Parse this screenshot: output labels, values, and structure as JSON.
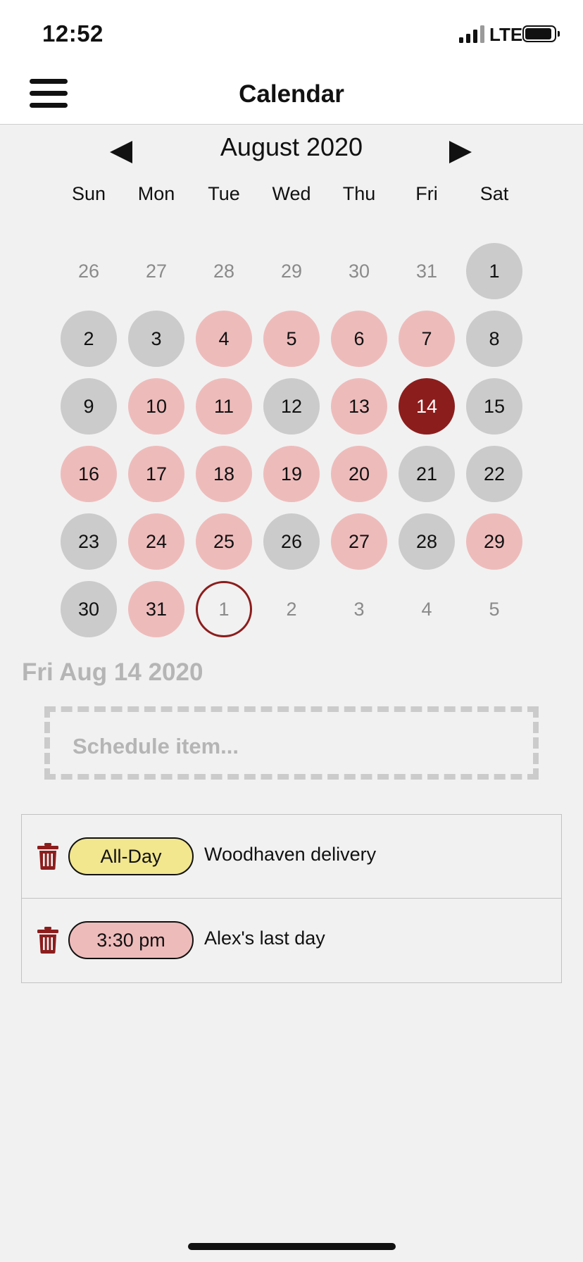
{
  "status_bar": {
    "time": "12:52",
    "network": "LTE"
  },
  "nav": {
    "title": "Calendar",
    "menu_icon": "hamburger-menu-icon"
  },
  "calendar": {
    "month_label": "August 2020",
    "prev_icon": "triangle-left-icon",
    "next_icon": "triangle-right-icon",
    "weekdays": [
      "Sun",
      "Mon",
      "Tue",
      "Wed",
      "Thu",
      "Fri",
      "Sat"
    ],
    "legend_colors": {
      "free": "#cbcbcb",
      "busy": "#eebbbb",
      "selected": "#8c1d1d",
      "today_ring": "#8c1d1d"
    },
    "days": [
      {
        "label": "26",
        "state": "out"
      },
      {
        "label": "27",
        "state": "out"
      },
      {
        "label": "28",
        "state": "out"
      },
      {
        "label": "29",
        "state": "out"
      },
      {
        "label": "30",
        "state": "out"
      },
      {
        "label": "31",
        "state": "out"
      },
      {
        "label": "1",
        "state": "free"
      },
      {
        "label": "2",
        "state": "free"
      },
      {
        "label": "3",
        "state": "free"
      },
      {
        "label": "4",
        "state": "busy"
      },
      {
        "label": "5",
        "state": "busy"
      },
      {
        "label": "6",
        "state": "busy"
      },
      {
        "label": "7",
        "state": "busy"
      },
      {
        "label": "8",
        "state": "free"
      },
      {
        "label": "9",
        "state": "free"
      },
      {
        "label": "10",
        "state": "busy"
      },
      {
        "label": "11",
        "state": "busy"
      },
      {
        "label": "12",
        "state": "free"
      },
      {
        "label": "13",
        "state": "busy"
      },
      {
        "label": "14",
        "state": "selected"
      },
      {
        "label": "15",
        "state": "free"
      },
      {
        "label": "16",
        "state": "busy"
      },
      {
        "label": "17",
        "state": "busy"
      },
      {
        "label": "18",
        "state": "busy"
      },
      {
        "label": "19",
        "state": "busy"
      },
      {
        "label": "20",
        "state": "busy"
      },
      {
        "label": "21",
        "state": "free"
      },
      {
        "label": "22",
        "state": "free"
      },
      {
        "label": "23",
        "state": "free"
      },
      {
        "label": "24",
        "state": "busy"
      },
      {
        "label": "25",
        "state": "busy"
      },
      {
        "label": "26",
        "state": "free"
      },
      {
        "label": "27",
        "state": "busy"
      },
      {
        "label": "28",
        "state": "free"
      },
      {
        "label": "29",
        "state": "busy"
      },
      {
        "label": "30",
        "state": "free"
      },
      {
        "label": "31",
        "state": "busy"
      },
      {
        "label": "1",
        "state": "today"
      },
      {
        "label": "2",
        "state": "out"
      },
      {
        "label": "3",
        "state": "out"
      },
      {
        "label": "4",
        "state": "out"
      },
      {
        "label": "5",
        "state": "out"
      }
    ]
  },
  "selected_date_label": "Fri Aug 14 2020",
  "schedule_input": {
    "placeholder": "Schedule item...",
    "value": ""
  },
  "events": [
    {
      "time_label": "All-Day",
      "title": "Woodhaven delivery",
      "pill_color": "#f2e68f",
      "icon": "trash-icon"
    },
    {
      "time_label": "3:30 pm",
      "title": "Alex's last day",
      "pill_color": "#eebbbb",
      "icon": "trash-icon"
    }
  ],
  "accent_color": "#8c1d1d"
}
